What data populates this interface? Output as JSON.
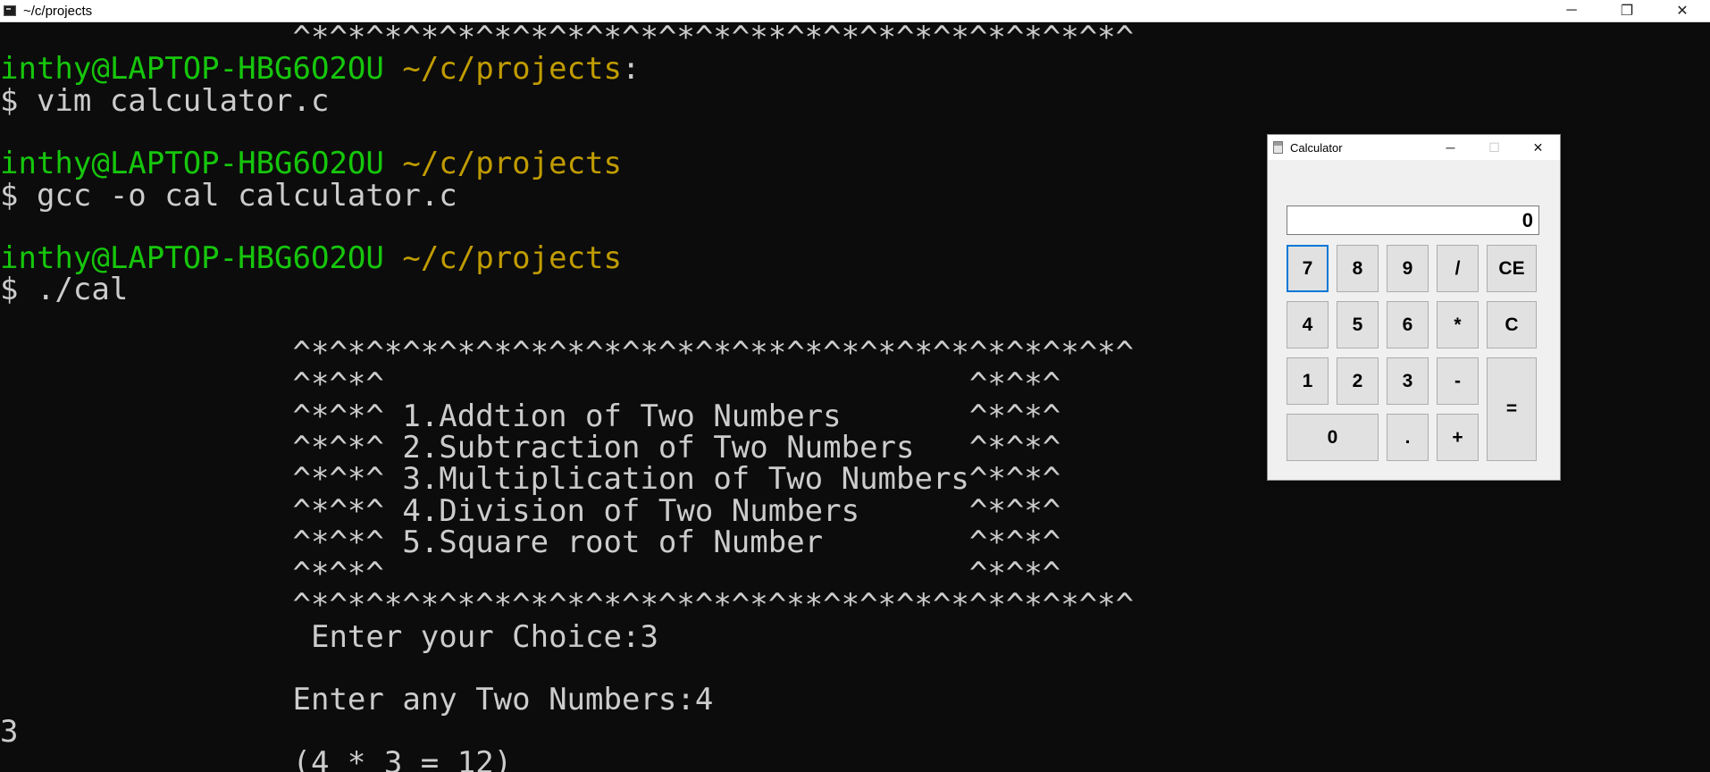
{
  "terminal": {
    "title": "~/c/projects",
    "window_buttons": {
      "minimize": "─",
      "restore": "❐",
      "close": "✕"
    },
    "lines": [
      {
        "segments": [
          {
            "text": "                ^*^*^*^*^*^*^*^*^*^*^*^*^**^*^*^*^*^*^*^*^*^*^",
            "c": ""
          }
        ]
      },
      {
        "segments": [
          {
            "text": "inthy@LAPTOP-HBG6O2OU ",
            "c": "g"
          },
          {
            "text": "~/c/projects",
            "c": "y"
          },
          {
            "text": ":",
            "c": ""
          }
        ]
      },
      {
        "segments": [
          {
            "text": "$ vim calculator.c",
            "c": ""
          }
        ]
      },
      {
        "segments": []
      },
      {
        "segments": [
          {
            "text": "inthy@LAPTOP-HBG6O2OU ",
            "c": "g"
          },
          {
            "text": "~/c/projects",
            "c": "y"
          }
        ]
      },
      {
        "segments": [
          {
            "text": "$ gcc -o cal calculator.c",
            "c": ""
          }
        ]
      },
      {
        "segments": []
      },
      {
        "segments": [
          {
            "text": "inthy@LAPTOP-HBG6O2OU ",
            "c": "g"
          },
          {
            "text": "~/c/projects",
            "c": "y"
          }
        ]
      },
      {
        "segments": [
          {
            "text": "$ ./cal",
            "c": ""
          }
        ]
      },
      {
        "segments": []
      },
      {
        "segments": [
          {
            "text": "                ^*^*^*^*^*^*^*^*^*^*^*^*^**^*^*^*^*^*^*^*^*^*^",
            "c": ""
          }
        ]
      },
      {
        "segments": [
          {
            "text": "                ^*^*^                                ^*^*^",
            "c": ""
          }
        ]
      },
      {
        "segments": [
          {
            "text": "                ^*^*^ 1.Addtion of Two Numbers       ^*^*^",
            "c": ""
          }
        ]
      },
      {
        "segments": [
          {
            "text": "                ^*^*^ 2.Subtraction of Two Numbers   ^*^*^",
            "c": ""
          }
        ]
      },
      {
        "segments": [
          {
            "text": "                ^*^*^ 3.Multiplication of Two Numbers^*^*^",
            "c": ""
          }
        ]
      },
      {
        "segments": [
          {
            "text": "                ^*^*^ 4.Division of Two Numbers      ^*^*^",
            "c": ""
          }
        ]
      },
      {
        "segments": [
          {
            "text": "                ^*^*^ 5.Square root of Number        ^*^*^",
            "c": ""
          }
        ]
      },
      {
        "segments": [
          {
            "text": "                ^*^*^                                ^*^*^",
            "c": ""
          }
        ]
      },
      {
        "segments": [
          {
            "text": "                ^*^*^*^*^*^*^*^*^*^*^*^*^*^**^*^*^*^*^*^*^*^*^",
            "c": ""
          }
        ]
      },
      {
        "segments": [
          {
            "text": "                 Enter your Choice:3",
            "c": ""
          }
        ]
      },
      {
        "segments": []
      },
      {
        "segments": [
          {
            "text": "                Enter any Two Numbers:4",
            "c": ""
          }
        ]
      },
      {
        "segments": [
          {
            "text": "3",
            "c": ""
          }
        ]
      },
      {
        "segments": [
          {
            "text": "                (4 * 3 = 12)",
            "c": ""
          }
        ]
      }
    ]
  },
  "calculator": {
    "title": "Calculator",
    "window_buttons": {
      "minimize": "─",
      "maximize": "☐",
      "close": "✕"
    },
    "display": "0",
    "keys": {
      "k7": "7",
      "k8": "8",
      "k9": "9",
      "div": "/",
      "ce": "CE",
      "k4": "4",
      "k5": "5",
      "k6": "6",
      "mul": "*",
      "c": "C",
      "k1": "1",
      "k2": "2",
      "k3": "3",
      "sub": "-",
      "eq": "=",
      "k0": "0",
      "dot": ".",
      "add": "+"
    }
  }
}
